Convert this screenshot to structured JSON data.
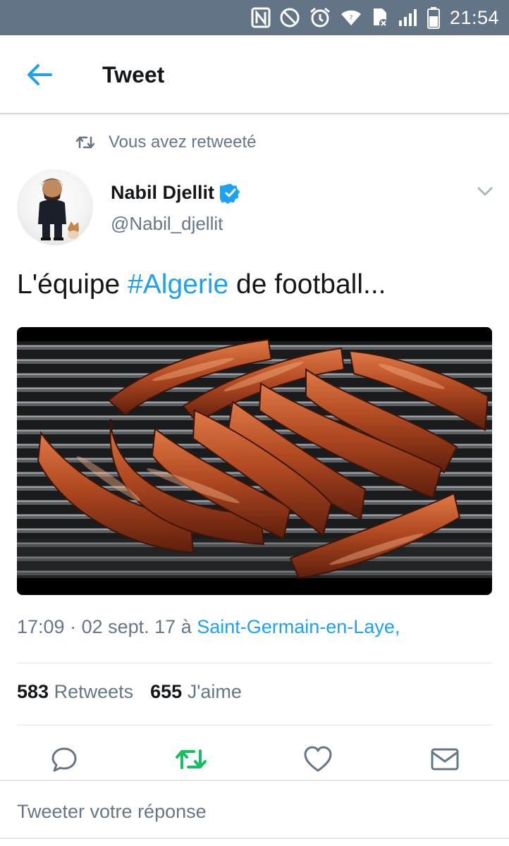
{
  "status_bar": {
    "time": "21:54",
    "icons": [
      "nfc-icon",
      "do-not-disturb-icon",
      "alarm-icon",
      "wifi-icon",
      "sd-card-icon",
      "signal-icon",
      "battery-icon"
    ]
  },
  "app_bar": {
    "title": "Tweet",
    "back_icon": "back-arrow-icon"
  },
  "retweet_context": {
    "label": "Vous avez retweeté"
  },
  "author": {
    "name": "Nabil Djellit",
    "handle": "@Nabil_djellit",
    "verified": true
  },
  "tweet": {
    "text_before": "L'équipe ",
    "hashtag": "#Algerie",
    "text_after": " de football..."
  },
  "meta": {
    "time": "17:09",
    "date_sep": " · ",
    "date": "02 sept. 17",
    "at": " à ",
    "place": "Saint-Germain-en-Laye,"
  },
  "stats": {
    "retweets_count": "583",
    "retweets_label": "Retweets",
    "likes_count": "655",
    "likes_label": "J'aime"
  },
  "actions": [
    "reply-icon",
    "retweet-icon",
    "like-icon",
    "direct-message-icon"
  ],
  "reply": {
    "placeholder": "Tweeter votre réponse"
  },
  "colors": {
    "status_bar": "#627486",
    "accent": "#1da1f2",
    "retweet_green": "#17bf63",
    "secondary_text": "#657786"
  }
}
